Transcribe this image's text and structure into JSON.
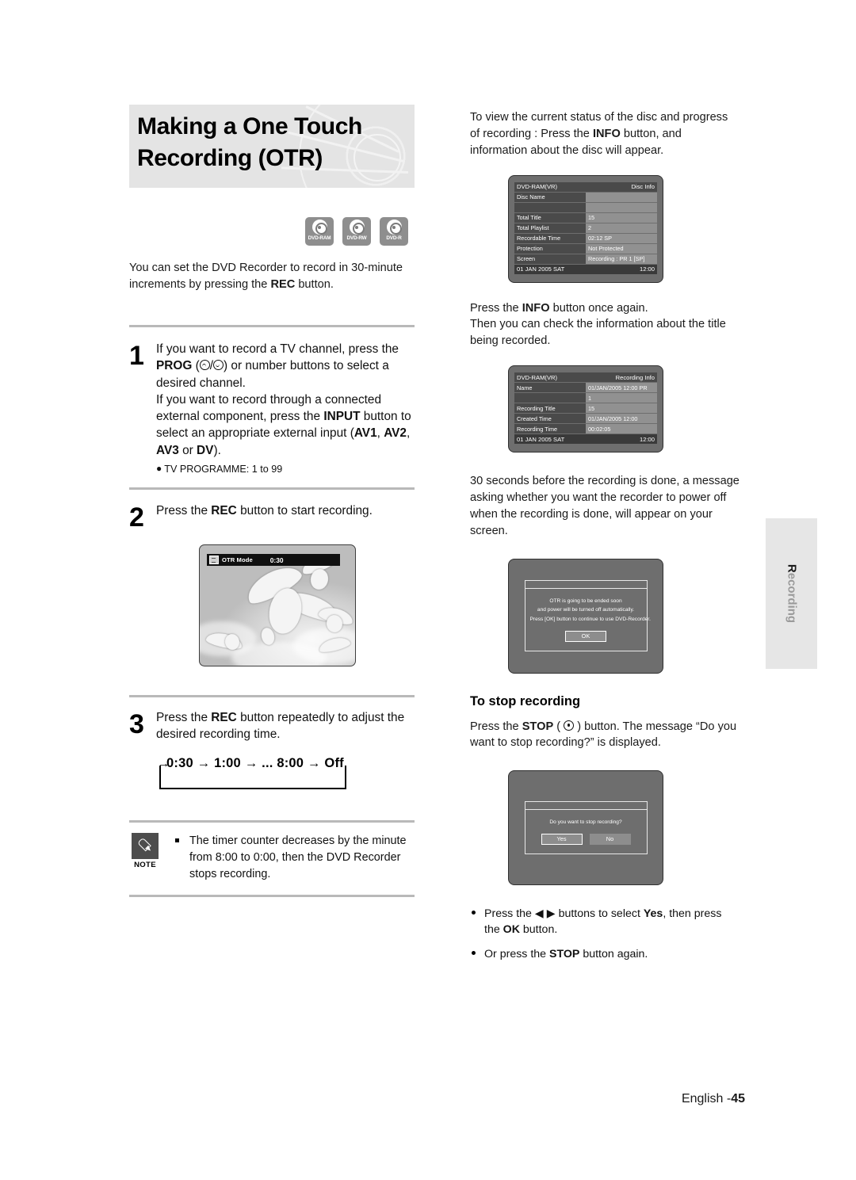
{
  "page": {
    "title_line1": "Making a One Touch",
    "title_line2": "Recording (OTR)",
    "footer_lang": "English -",
    "footer_page": "45",
    "side_tab_first": "R",
    "side_tab_rest": "ecording"
  },
  "disc_logos": [
    {
      "label": "DVD-RAM"
    },
    {
      "label": "DVD-RW"
    },
    {
      "label": "DVD-R"
    }
  ],
  "left": {
    "intro_a": "You can set the DVD Recorder to record in 30-minute increments by pressing the ",
    "intro_rec": "REC",
    "intro_b": " button.",
    "step1": {
      "number": "1",
      "t1": "If you want to record a TV channel, press the ",
      "prog": "PROG",
      "t2": " (",
      "t3": "/",
      "t4": ") or number buttons to select a desired channel.",
      "t5": "If you want to record through a connected external component, press the ",
      "input": "INPUT",
      "t6": " button to select an appropriate external input (",
      "av1": "AV1",
      "av2": "AV2",
      "av3": "AV3",
      "dv": "DV",
      "t7": ").",
      "bullet": "TV PROGRAMME: 1 to 99"
    },
    "step2": {
      "number": "2",
      "t1": "Press the ",
      "rec": "REC",
      "t2": " button to start recording.",
      "osd_label": "OTR Mode",
      "osd_time": "0:30"
    },
    "step3": {
      "number": "3",
      "t1": "Press the ",
      "rec": "REC",
      "t2": " button repeatedly to adjust the desired recording time.",
      "loop": "0:30 → 1:00 → ... 8:00 → Off"
    },
    "note": {
      "badge": "NOTE",
      "text": "The timer counter decreases by the minute from 8:00 to 0:00, then the DVD Recorder stops recording."
    }
  },
  "right": {
    "para1_a": "To view the current status of the disc and progress of recording : Press the ",
    "para1_info": "INFO",
    "para1_b": " button, and information about the disc will appear.",
    "disc_info": {
      "header_left": "DVD-RAM(VR)",
      "header_right": "Disc Info",
      "rows": [
        {
          "label": "Disc Name",
          "value": ""
        },
        {
          "label": "",
          "value": ""
        },
        {
          "label": "Total Title",
          "value": "15"
        },
        {
          "label": "Total Playlist",
          "value": "2"
        },
        {
          "label": "Recordable Time",
          "value": "02:12   SP"
        },
        {
          "label": "Protection",
          "value": "Not Protected"
        },
        {
          "label": "Screen",
          "value": "Recording :   PR 1 [SP]"
        }
      ],
      "footer_left": "01 JAN 2005 SAT",
      "footer_right": "12:00"
    },
    "para2_a": "Press the ",
    "para2_info": "INFO",
    "para2_b": " button once again.",
    "para2_c": "Then you can check the information about the title being recorded.",
    "recording_info": {
      "header_left": "DVD-RAM(VR)",
      "header_right": "Recording Info",
      "rows": [
        {
          "label": "Name",
          "value": "01/JAN/2005 12:00 PR"
        },
        {
          "label": "",
          "value": "1"
        },
        {
          "label": "Recording Title",
          "value": "15"
        },
        {
          "label": "Created Time",
          "value": "01/JAN/2005 12:00"
        },
        {
          "label": "Recording Time",
          "value": "00:02:05"
        }
      ],
      "footer_left": "01 JAN 2005 SAT",
      "footer_right": "12:00"
    },
    "para3": "30 seconds before the recording is done, a message asking whether you want the recorder to power off when the recording is done, will appear on your screen.",
    "otr_dialog": {
      "line1": "OTR is going to be ended soon",
      "line2": "and power will be turned off automatically.",
      "line3": "Press [OK] button to continue to use DVD-Recorder.",
      "ok_button": "OK"
    },
    "stop_heading": "To stop recording",
    "stop_para_a": "Press the ",
    "stop_para_stop": "STOP",
    "stop_para_b": " ( ",
    "stop_para_c": " ) button. The message “Do you want to stop recording?” is displayed.",
    "stop_dialog": {
      "question": "Do you want to stop recording?",
      "yes_button": "Yes",
      "no_button": "No"
    },
    "bullet1_a": "Press the ",
    "bullet1_arrows": "◀ ▶",
    "bullet1_b": " buttons to select ",
    "bullet1_yes": "Yes",
    "bullet1_c": ", then press the ",
    "bullet1_ok": "OK",
    "bullet1_d": " button.",
    "bullet2_a": "Or press the ",
    "bullet2_stop": "STOP",
    "bullet2_b": " button again."
  }
}
